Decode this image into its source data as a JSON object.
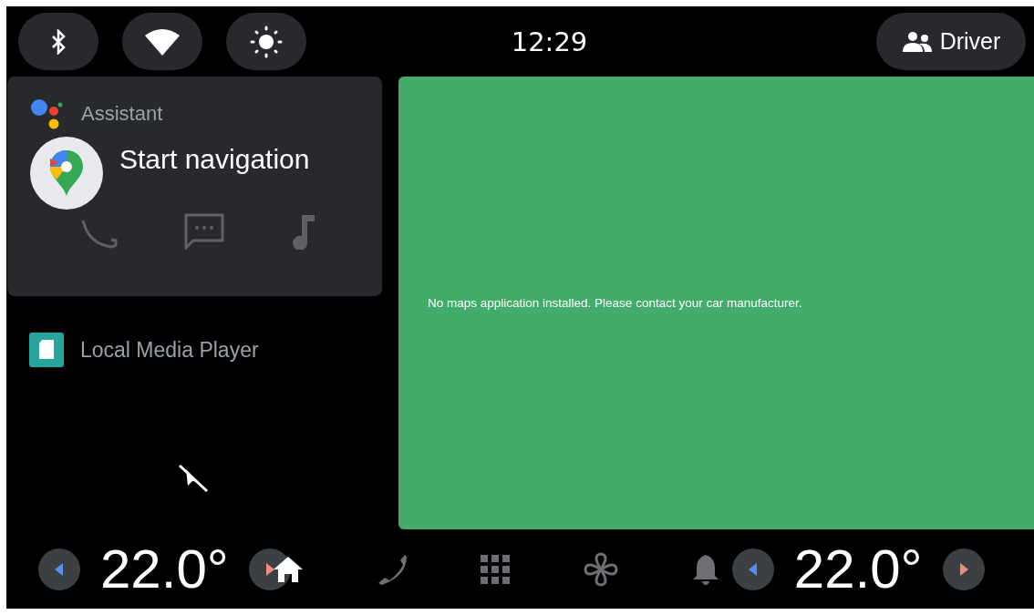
{
  "status_bar": {
    "quick_settings": [
      {
        "kind": "bluetooth"
      },
      {
        "kind": "wifi"
      },
      {
        "kind": "brightness"
      }
    ],
    "clock": "12:29",
    "profile": {
      "label": "Driver"
    }
  },
  "assistant_card": {
    "title": "Assistant",
    "suggestion": "Start navigation",
    "actions": [
      {
        "kind": "phone"
      },
      {
        "kind": "message"
      },
      {
        "kind": "music"
      }
    ]
  },
  "media_card": {
    "title": "Local Media Player"
  },
  "map_panel": {
    "message": "No maps application installed. Please contact your car manufacturer."
  },
  "bottom_bar": {
    "climate_left": {
      "temperature": "22.0°"
    },
    "nav": [
      {
        "kind": "home",
        "selected": true
      },
      {
        "kind": "phone",
        "selected": false
      },
      {
        "kind": "apps",
        "selected": false
      },
      {
        "kind": "fan",
        "selected": false
      },
      {
        "kind": "notifications",
        "selected": false
      }
    ],
    "climate_right": {
      "temperature": "22.0°"
    }
  }
}
